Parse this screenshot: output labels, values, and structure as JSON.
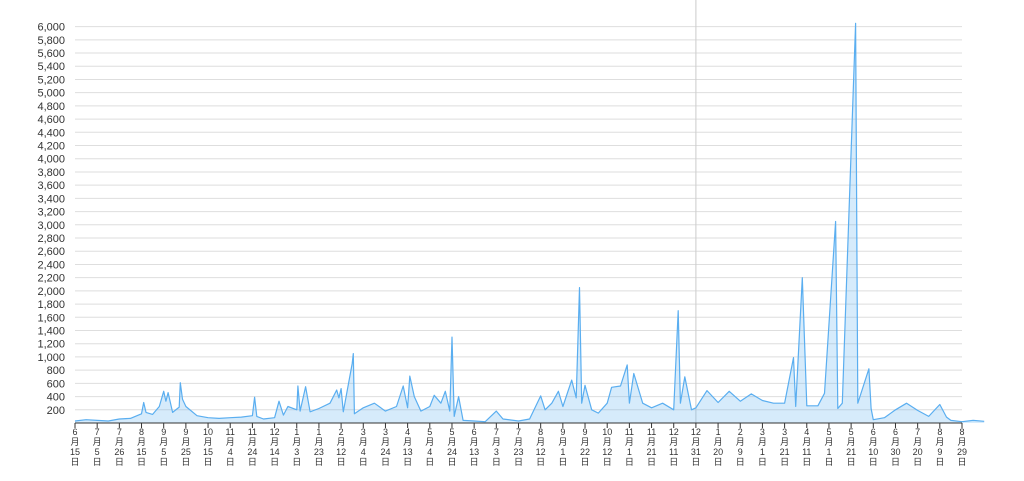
{
  "chart_data": {
    "type": "line",
    "title": "",
    "xlabel": "",
    "ylabel": "",
    "ylim": [
      0,
      6100
    ],
    "yticks": [
      200,
      400,
      600,
      800,
      1000,
      1200,
      1400,
      1600,
      1800,
      2000,
      2200,
      2400,
      2600,
      2800,
      3000,
      3200,
      3400,
      3600,
      3800,
      4000,
      4200,
      4400,
      4600,
      4800,
      5000,
      5200,
      5400,
      5600,
      5800,
      6000
    ],
    "ytick_labels": [
      "200",
      "400",
      "600",
      "800",
      "1,000",
      "1,200",
      "1,400",
      "1,600",
      "1,800",
      "2,000",
      "2,200",
      "2,400",
      "2,600",
      "2,800",
      "3,000",
      "3,200",
      "3,400",
      "3,600",
      "3,800",
      "4,000",
      "4,200",
      "4,400",
      "4,600",
      "4,800",
      "5,000",
      "5,200",
      "5,400",
      "5,600",
      "5,800",
      "6,000"
    ],
    "x_tick_labels": [
      {
        "month": "6",
        "day": "15"
      },
      {
        "month": "7",
        "day": "5"
      },
      {
        "month": "7",
        "day": "26"
      },
      {
        "month": "8",
        "day": "15"
      },
      {
        "month": "9",
        "day": "5"
      },
      {
        "month": "9",
        "day": "25"
      },
      {
        "month": "10",
        "day": "15"
      },
      {
        "month": "11",
        "day": "4"
      },
      {
        "month": "11",
        "day": "24"
      },
      {
        "month": "12",
        "day": "14"
      },
      {
        "month": "1",
        "day": "3"
      },
      {
        "month": "1",
        "day": "23"
      },
      {
        "month": "2",
        "day": "12"
      },
      {
        "month": "3",
        "day": "4"
      },
      {
        "month": "3",
        "day": "24"
      },
      {
        "month": "4",
        "day": "13"
      },
      {
        "month": "5",
        "day": "4"
      },
      {
        "month": "5",
        "day": "24"
      },
      {
        "month": "6",
        "day": "13"
      },
      {
        "month": "7",
        "day": "3"
      },
      {
        "month": "7",
        "day": "23"
      },
      {
        "month": "8",
        "day": "12"
      },
      {
        "month": "9",
        "day": "1"
      },
      {
        "month": "9",
        "day": "22"
      },
      {
        "month": "10",
        "day": "12"
      },
      {
        "month": "11",
        "day": "1"
      },
      {
        "month": "11",
        "day": "21"
      },
      {
        "month": "12",
        "day": "11"
      },
      {
        "month": "12",
        "day": "31"
      },
      {
        "month": "1",
        "day": "20"
      },
      {
        "month": "2",
        "day": "9"
      },
      {
        "month": "3",
        "day": "1"
      },
      {
        "month": "3",
        "day": "21"
      },
      {
        "month": "4",
        "day": "11"
      },
      {
        "month": "5",
        "day": "1"
      },
      {
        "month": "5",
        "day": "21"
      },
      {
        "month": "6",
        "day": "10"
      },
      {
        "month": "6",
        "day": "30"
      },
      {
        "month": "7",
        "day": "20"
      },
      {
        "month": "8",
        "day": "9"
      },
      {
        "month": "8",
        "day": "29"
      }
    ],
    "month_char": "月",
    "day_char": "日",
    "reference_line_at_tick": 28,
    "grid": true,
    "series": [
      {
        "color": "#5aaef0",
        "points": [
          [
            0,
            30
          ],
          [
            0.5,
            50
          ],
          [
            1,
            40
          ],
          [
            1.5,
            30
          ],
          [
            2,
            60
          ],
          [
            2.5,
            70
          ],
          [
            3,
            140
          ],
          [
            3.1,
            310
          ],
          [
            3.2,
            160
          ],
          [
            3.5,
            130
          ],
          [
            3.8,
            250
          ],
          [
            4,
            480
          ],
          [
            4.1,
            330
          ],
          [
            4.2,
            460
          ],
          [
            4.4,
            160
          ],
          [
            4.7,
            240
          ],
          [
            4.75,
            610
          ],
          [
            4.85,
            360
          ],
          [
            5,
            250
          ],
          [
            5.5,
            110
          ],
          [
            6,
            80
          ],
          [
            6.5,
            70
          ],
          [
            7,
            80
          ],
          [
            7.5,
            90
          ],
          [
            8,
            110
          ],
          [
            8.1,
            390
          ],
          [
            8.2,
            100
          ],
          [
            8.5,
            60
          ],
          [
            9,
            80
          ],
          [
            9.2,
            330
          ],
          [
            9.4,
            120
          ],
          [
            9.6,
            250
          ],
          [
            10,
            200
          ],
          [
            10.05,
            560
          ],
          [
            10.15,
            180
          ],
          [
            10.4,
            550
          ],
          [
            10.6,
            170
          ],
          [
            11,
            220
          ],
          [
            11.5,
            300
          ],
          [
            11.8,
            500
          ],
          [
            11.9,
            380
          ],
          [
            12,
            520
          ],
          [
            12.1,
            170
          ],
          [
            12.5,
            900
          ],
          [
            12.55,
            1050
          ],
          [
            12.6,
            140
          ],
          [
            13,
            230
          ],
          [
            13.5,
            300
          ],
          [
            14,
            180
          ],
          [
            14.5,
            250
          ],
          [
            14.8,
            560
          ],
          [
            15,
            230
          ],
          [
            15.1,
            710
          ],
          [
            15.3,
            400
          ],
          [
            15.6,
            180
          ],
          [
            16,
            250
          ],
          [
            16.2,
            420
          ],
          [
            16.5,
            300
          ],
          [
            16.7,
            480
          ],
          [
            16.9,
            180
          ],
          [
            17,
            1300
          ],
          [
            17.1,
            100
          ],
          [
            17.3,
            400
          ],
          [
            17.5,
            40
          ],
          [
            18,
            30
          ],
          [
            18.5,
            20
          ],
          [
            19,
            180
          ],
          [
            19.3,
            60
          ],
          [
            20,
            30
          ],
          [
            20.5,
            60
          ],
          [
            21,
            410
          ],
          [
            21.2,
            200
          ],
          [
            21.5,
            300
          ],
          [
            21.8,
            480
          ],
          [
            22,
            250
          ],
          [
            22.4,
            650
          ],
          [
            22.6,
            380
          ],
          [
            22.75,
            2050
          ],
          [
            22.85,
            300
          ],
          [
            23,
            570
          ],
          [
            23.3,
            200
          ],
          [
            23.6,
            150
          ],
          [
            24,
            300
          ],
          [
            24.2,
            540
          ],
          [
            24.6,
            560
          ],
          [
            24.9,
            880
          ],
          [
            25,
            300
          ],
          [
            25.2,
            750
          ],
          [
            25.6,
            300
          ],
          [
            26,
            230
          ],
          [
            26.5,
            300
          ],
          [
            27,
            200
          ],
          [
            27.2,
            1700
          ],
          [
            27.3,
            300
          ],
          [
            27.5,
            700
          ],
          [
            27.8,
            200
          ],
          [
            28,
            230
          ],
          [
            28.5,
            490
          ],
          [
            29,
            310
          ],
          [
            29.5,
            480
          ],
          [
            30,
            330
          ],
          [
            30.5,
            440
          ],
          [
            31,
            340
          ],
          [
            31.5,
            300
          ],
          [
            32,
            300
          ],
          [
            32.4,
            990
          ],
          [
            32.5,
            250
          ],
          [
            32.8,
            2200
          ],
          [
            33,
            260
          ],
          [
            33.5,
            260
          ],
          [
            33.8,
            450
          ],
          [
            34.3,
            3050
          ],
          [
            34.4,
            220
          ],
          [
            34.6,
            300
          ],
          [
            35.2,
            6050
          ],
          [
            35.3,
            300
          ],
          [
            35.8,
            820
          ],
          [
            35.9,
            220
          ],
          [
            36,
            50
          ],
          [
            36.5,
            80
          ],
          [
            37,
            200
          ],
          [
            37.5,
            300
          ],
          [
            38,
            190
          ],
          [
            38.5,
            100
          ],
          [
            39,
            280
          ],
          [
            39.3,
            90
          ],
          [
            39.5,
            40
          ],
          [
            40,
            20
          ],
          [
            40.5,
            40
          ],
          [
            41,
            25
          ]
        ]
      }
    ]
  }
}
